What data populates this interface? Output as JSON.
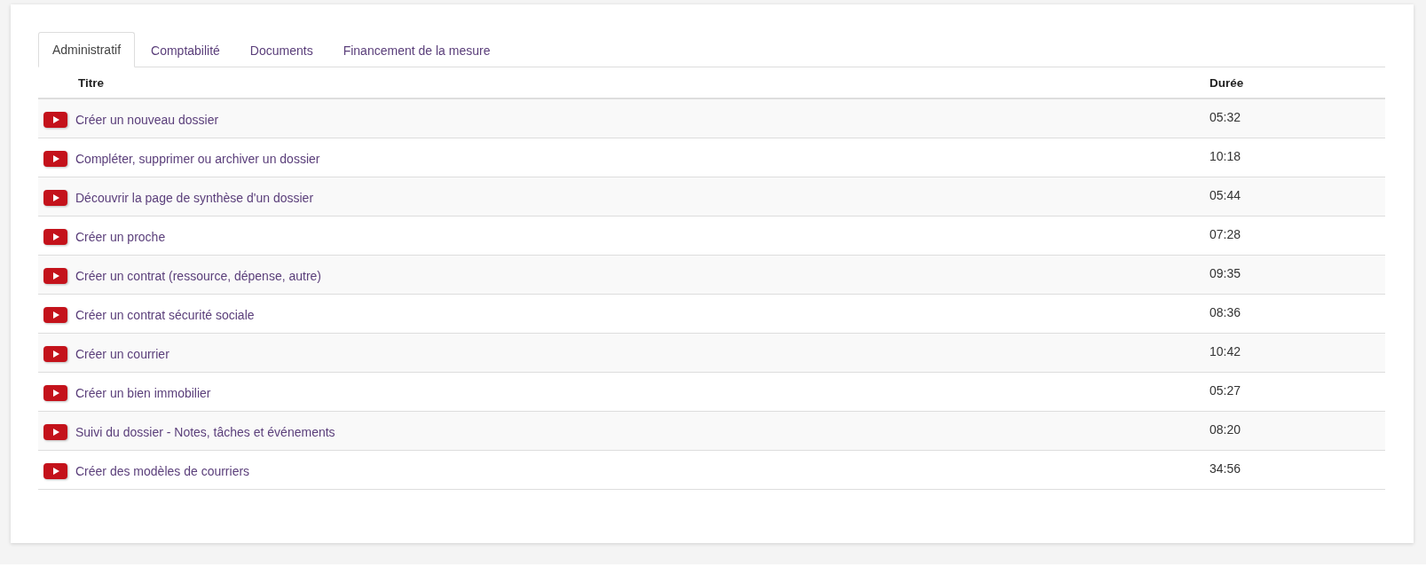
{
  "tabs": [
    {
      "label": "Administratif",
      "selected": true
    },
    {
      "label": "Comptabilité",
      "selected": false
    },
    {
      "label": "Documents",
      "selected": false
    },
    {
      "label": "Financement de la mesure",
      "selected": false
    }
  ],
  "table": {
    "columns": [
      "Titre",
      "Durée"
    ],
    "rows": [
      {
        "title": "Créer un nouveau dossier",
        "duration": "05:32"
      },
      {
        "title": "Compléter, supprimer ou archiver un dossier",
        "duration": "10:18"
      },
      {
        "title": "Découvrir la page de synthèse d'un dossier",
        "duration": "05:44"
      },
      {
        "title": "Créer un proche",
        "duration": "07:28"
      },
      {
        "title": "Créer un contrat (ressource, dépense, autre)",
        "duration": "09:35"
      },
      {
        "title": "Créer un contrat sécurité sociale",
        "duration": "08:36"
      },
      {
        "title": "Créer un courrier",
        "duration": "10:42"
      },
      {
        "title": "Créer un bien immobilier",
        "duration": "05:27"
      },
      {
        "title": "Suivi du dossier - Notes, tâches et événements",
        "duration": "08:20"
      },
      {
        "title": "Créer des modèles de courriers",
        "duration": "34:56"
      }
    ]
  }
}
